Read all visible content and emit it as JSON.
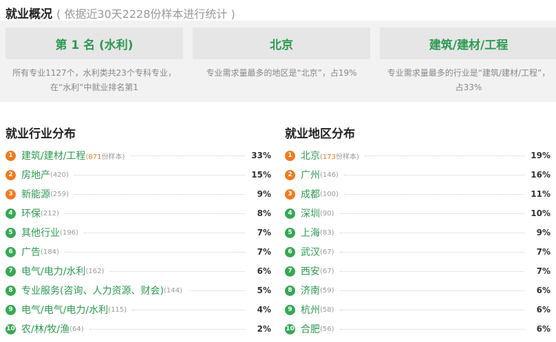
{
  "overview": {
    "title": "就业概况",
    "subtitle": "( 依据近30天2228份样本进行统计 )",
    "cards": [
      {
        "heading": "第 1 名 (水利)",
        "desc": "所有专业1127个，水利类共23个专科专业，在“水利”中就业排名第1"
      },
      {
        "heading": "北京",
        "desc": "专业需求量最多的地区是“北京”，占19%"
      },
      {
        "heading": "建筑/建材/工程",
        "desc": "专业需求量最多的行业是“建筑/建材/工程”，占33%"
      }
    ]
  },
  "industry": {
    "title": "就业行业分布",
    "items": [
      {
        "rank": "1",
        "name": "建筑/建材/工程",
        "count": "871",
        "count_suffix": "份样本",
        "pct": "33%"
      },
      {
        "rank": "2",
        "name": "房地产",
        "count": "420",
        "pct": "15%"
      },
      {
        "rank": "3",
        "name": "新能源",
        "count": "259",
        "pct": "9%"
      },
      {
        "rank": "4",
        "name": "环保",
        "count": "212",
        "pct": "8%"
      },
      {
        "rank": "5",
        "name": "其他行业",
        "count": "196",
        "pct": "7%"
      },
      {
        "rank": "6",
        "name": "广告",
        "count": "184",
        "pct": "7%"
      },
      {
        "rank": "7",
        "name": "电气/电力/水利",
        "count": "162",
        "pct": "6%"
      },
      {
        "rank": "8",
        "name": "专业服务(咨询、人力资源、财会)",
        "count": "144",
        "pct": "5%"
      },
      {
        "rank": "9",
        "name": "电气/电气/电力/水利",
        "count": "115",
        "pct": "4%"
      },
      {
        "rank": "10",
        "name": "农/林/牧/渔",
        "count": "64",
        "pct": "2%"
      }
    ]
  },
  "region": {
    "title": "就业地区分布",
    "items": [
      {
        "rank": "1",
        "name": "北京",
        "count": "173",
        "count_suffix": "份样本",
        "pct": "19%"
      },
      {
        "rank": "2",
        "name": "广州",
        "count": "146",
        "pct": "16%"
      },
      {
        "rank": "3",
        "name": "成都",
        "count": "100",
        "pct": "11%"
      },
      {
        "rank": "4",
        "name": "深圳",
        "count": "90",
        "pct": "10%"
      },
      {
        "rank": "5",
        "name": "上海",
        "count": "83",
        "pct": "9%"
      },
      {
        "rank": "6",
        "name": "武汉",
        "count": "67",
        "pct": "7%"
      },
      {
        "rank": "7",
        "name": "西安",
        "count": "67",
        "pct": "7%"
      },
      {
        "rank": "8",
        "name": "济南",
        "count": "59",
        "pct": "6%"
      },
      {
        "rank": "9",
        "name": "杭州",
        "count": "58",
        "pct": "6%"
      },
      {
        "rank": "10",
        "name": "合肥",
        "count": "56",
        "pct": "6%"
      }
    ]
  }
}
